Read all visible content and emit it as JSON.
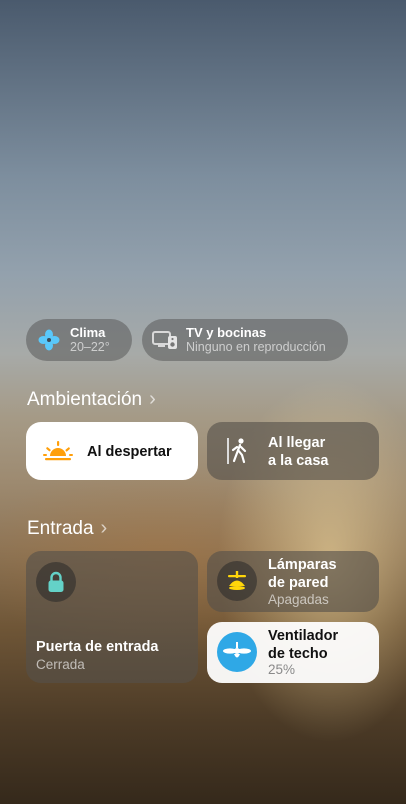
{
  "climate": {
    "title": "Clima",
    "value": "20–22°"
  },
  "tv": {
    "title": "TV y bocinas",
    "status": "Ninguno en reproducción"
  },
  "scenes": {
    "header": "Ambientación",
    "chevron": "›",
    "wake": {
      "label": "Al despertar"
    },
    "arrive": {
      "line1": "Al llegar",
      "line2": "a la casa"
    }
  },
  "entrance": {
    "header": "Entrada",
    "chevron": "›",
    "door": {
      "name": "Puerta de entrada",
      "status": "Cerrada"
    },
    "lamps": {
      "line1": "Lámparas",
      "line2": "de pared",
      "status": "Apagadas"
    },
    "fan": {
      "line1": "Ventilador",
      "line2": "de techo",
      "status": "25%"
    }
  },
  "colors": {
    "climate_icon": "#5ac8fa",
    "wake_icon": "#ff9f0a",
    "lock_icon": "#64d2c8",
    "lamp_icon": "#ffd60a",
    "fan_bg": "#2fa8e6"
  }
}
